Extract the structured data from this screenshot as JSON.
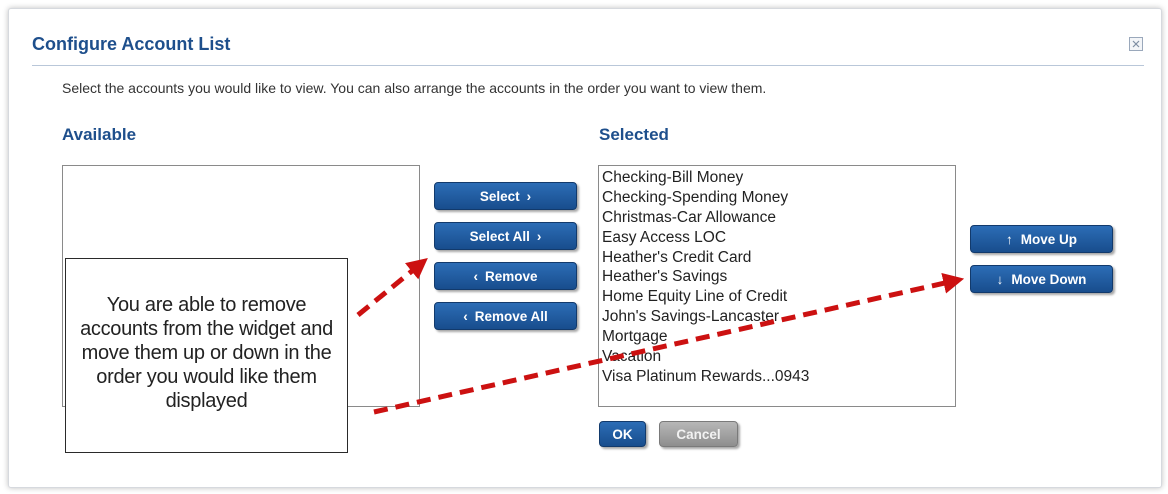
{
  "dialog": {
    "title": "Configure Account List",
    "instructions": "Select the accounts you would like to view. You can also arrange the accounts in the order you want to view them."
  },
  "available": {
    "label": "Available",
    "items": []
  },
  "selected": {
    "label": "Selected",
    "items": [
      "Checking-Bill Money",
      "Checking-Spending Money",
      "Christmas-Car Allowance",
      "Easy Access LOC",
      "Heather's Credit Card",
      "Heather's Savings",
      "Home Equity Line of Credit",
      "John's Savings-Lancaster",
      "Mortgage",
      "Vacation",
      "Visa Platinum Rewards...0943"
    ]
  },
  "transfer_buttons": {
    "select": "Select",
    "select_all": "Select All",
    "remove": "Remove",
    "remove_all": "Remove All"
  },
  "order_buttons": {
    "move_up": "Move Up",
    "move_down": "Move Down"
  },
  "footer": {
    "ok": "OK",
    "cancel": "Cancel"
  },
  "callout": {
    "text": "You are able to remove accounts from the widget and move them up or down in the order you would like them displayed"
  },
  "colors": {
    "accent": "#1e4f8c",
    "button": "#1f5a9f",
    "annotation_arrow": "#cc1111"
  }
}
